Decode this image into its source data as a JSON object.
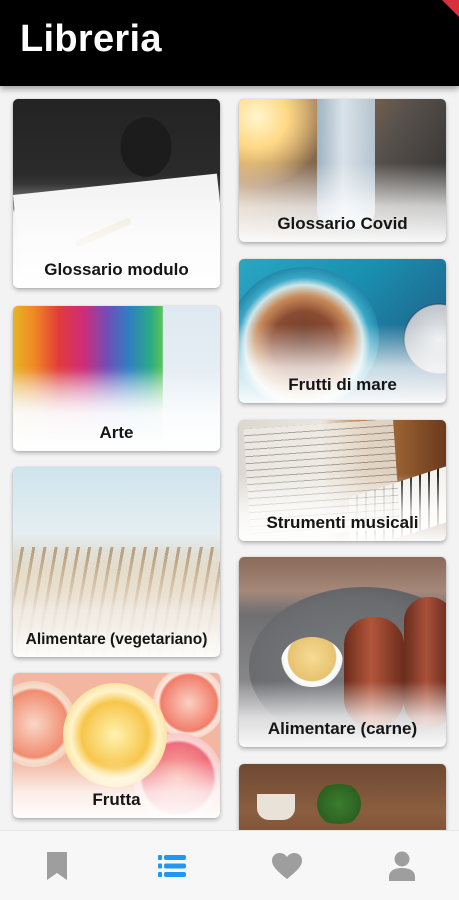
{
  "app": {
    "title": "Libreria"
  },
  "colors": {
    "appbar": "#000000",
    "accent": "#2196f3",
    "inactive_icon": "#9e9e9e"
  },
  "cards": {
    "glossario_modulo": {
      "label": "Glossario modulo"
    },
    "glossario_covid": {
      "label": "Glossario Covid"
    },
    "frutti_di_mare": {
      "label": "Frutti di mare"
    },
    "arte": {
      "label": "Arte"
    },
    "strumenti_musicali": {
      "label": "Strumenti musicali"
    },
    "alimentare_vegetariano": {
      "label": "Alimentare (vegetariano)"
    },
    "alimentare_carne": {
      "label": "Alimentare (carne)"
    },
    "frutta": {
      "label": "Frutta"
    },
    "partial_card": {
      "label": ""
    }
  },
  "bottom_nav": {
    "selected": "library",
    "items": [
      {
        "id": "bookmarks",
        "icon": "bookmark-icon"
      },
      {
        "id": "library",
        "icon": "list-icon"
      },
      {
        "id": "favorites",
        "icon": "heart-icon"
      },
      {
        "id": "profile",
        "icon": "person-icon"
      }
    ]
  }
}
